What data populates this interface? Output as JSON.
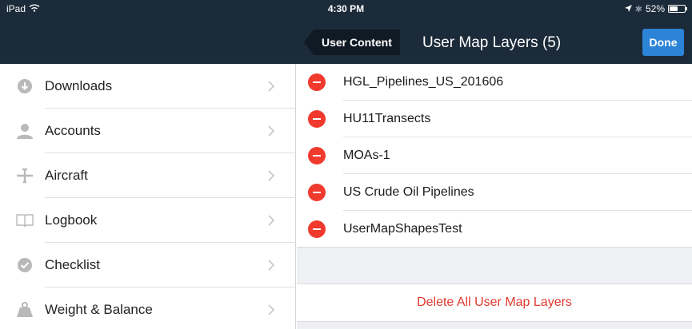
{
  "status_bar": {
    "device": "iPad",
    "time": "4:30 PM",
    "battery": "52%",
    "battery_level": 0.52
  },
  "navbar": {
    "back_label": "User Content",
    "title": "User Map Layers (5)",
    "done_label": "Done"
  },
  "sidebar": {
    "items": [
      {
        "label": "Downloads",
        "icon": "download-icon"
      },
      {
        "label": "Accounts",
        "icon": "user-icon"
      },
      {
        "label": "Aircraft",
        "icon": "airplane-icon"
      },
      {
        "label": "Logbook",
        "icon": "book-icon"
      },
      {
        "label": "Checklist",
        "icon": "checkmark-icon"
      },
      {
        "label": "Weight & Balance",
        "icon": "weight-icon"
      }
    ]
  },
  "layers": {
    "items": [
      {
        "name": "HGL_Pipelines_US_201606"
      },
      {
        "name": "HU11Transects"
      },
      {
        "name": "MOAs-1"
      },
      {
        "name": "US Crude Oil Pipelines"
      },
      {
        "name": "UserMapShapesTest"
      }
    ],
    "delete_all_label": "Delete All User Map Layers"
  },
  "colors": {
    "nav_bg": "#1c2b3a",
    "accent": "#2b84d8",
    "destructive": "#e0392e",
    "minus": "#f03a2e",
    "icon_gray": "#b9b9b9"
  }
}
